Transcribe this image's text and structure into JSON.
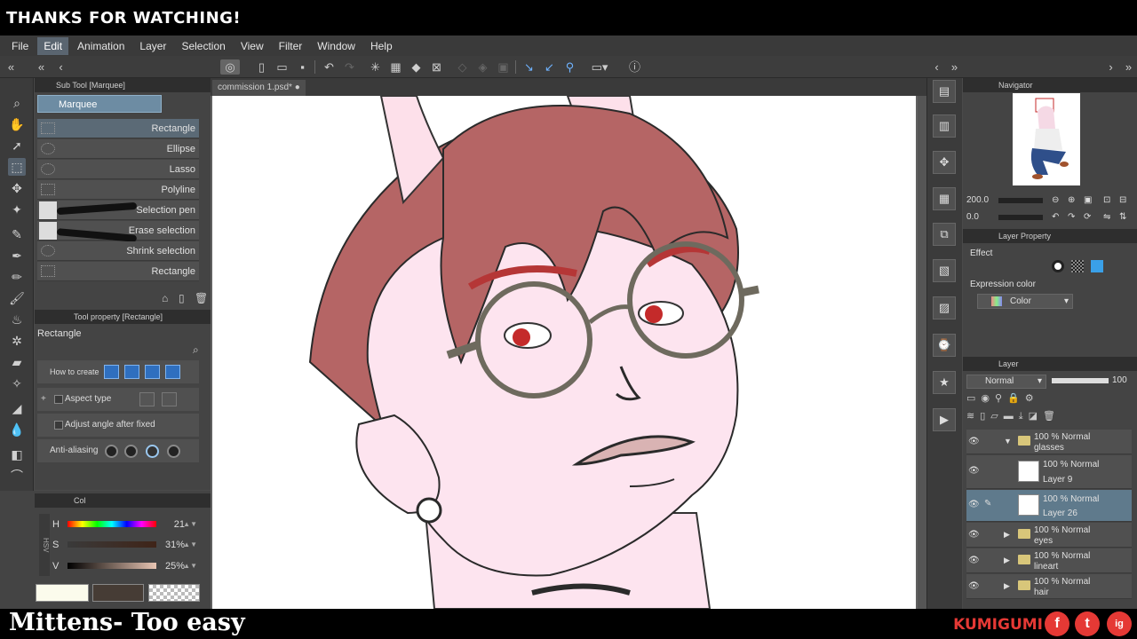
{
  "overlay": {
    "banner_text": "THANKS FOR WATCHING!",
    "song_title": "Mittens- Too easy",
    "brand": "KUMIGUMI",
    "social": [
      "f",
      "t",
      "ig"
    ]
  },
  "menu": [
    "File",
    "Edit",
    "Animation",
    "Layer",
    "Selection",
    "View",
    "Filter",
    "Window",
    "Help"
  ],
  "menu_active": "Edit",
  "document_tab": "commission 1.psd*",
  "subtool": {
    "panel_title": "Sub Tool [Marquee]",
    "group_tab": "Marquee",
    "items": [
      "Rectangle",
      "Ellipse",
      "Lasso",
      "Polyline",
      "Selection pen",
      "Erase selection",
      "Shrink selection",
      "Rectangle"
    ],
    "selected_index": 0
  },
  "toolprop": {
    "panel_title": "Tool property [Rectangle]",
    "tool_name": "Rectangle",
    "how_to_create": "How to create",
    "aspect_type": "Aspect type",
    "adjust_angle": "Adjust angle after fixed",
    "anti_aliasing": "Anti-aliasing"
  },
  "color": {
    "panel_title": "Col",
    "h_label": "H",
    "h_value": "21",
    "s_label": "S",
    "s_value": "31%",
    "v_label": "V",
    "v_value": "25%",
    "mode_label": "HSV",
    "main_color": "#fbfbec",
    "sub_color": "#463c35"
  },
  "navigator": {
    "title": "Navigator",
    "zoom": "200.0",
    "rotation": "0.0"
  },
  "layer_property": {
    "title": "Layer Property",
    "effect": "Effect",
    "expression_color": "Expression color",
    "color_value": "Color"
  },
  "layer_panel": {
    "title": "Layer",
    "blend_mode": "Normal",
    "opacity": "100",
    "layers": [
      {
        "top": "100 % Normal",
        "name": "glasses",
        "kind": "folder"
      },
      {
        "top": "100 % Normal",
        "name": "Layer 9",
        "kind": "raster"
      },
      {
        "top": "100 % Normal",
        "name": "Layer 26",
        "kind": "raster"
      },
      {
        "top": "100 % Normal",
        "name": "eyes",
        "kind": "folder"
      },
      {
        "top": "100 % Normal",
        "name": "lineart",
        "kind": "folder"
      },
      {
        "top": "100 % Normal",
        "name": "hair",
        "kind": "folder"
      }
    ],
    "selected_index": 2
  }
}
